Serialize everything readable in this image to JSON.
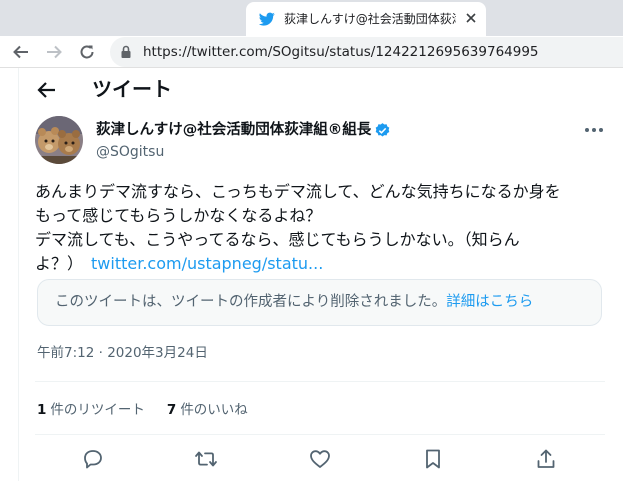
{
  "browser": {
    "tab_title": "荻津しんすけ@社会活動団体荻津組®組長",
    "url": "https://twitter.com/SOgitsu/status/1242212695639764995"
  },
  "header": {
    "title": "ツイート"
  },
  "tweet": {
    "author_name": "荻津しんすけ@社会活動団体荻津組®組長",
    "handle": "@SOgitsu",
    "text_lines": [
      "あんまりデマ流すなら、こっちもデマ流して、どんな気持ちになるか身を",
      "もって感じてもらうしかなくなるよね？",
      "デマ流しても、こうやってるなら、感じてもらうしかない。（知らん",
      "よ？）"
    ],
    "link_text": "twitter.com/ustapneg/statu...",
    "deleted_notice": "このツイートは、ツイートの作成者により削除されました。",
    "deleted_link": "詳細はこちら",
    "timestamp": "午前7:12 · 2020年3月24日",
    "retweet_count": "1",
    "retweet_label": "件のリツイート",
    "like_count": "7",
    "like_label": "件のいいね"
  },
  "icons": {
    "tab": "twitter-bird-icon",
    "close": "close-icon",
    "back": "back-arrow-icon",
    "forward": "forward-arrow-icon",
    "reload": "reload-icon",
    "lock": "lock-icon",
    "verified": "verified-badge-icon",
    "more": "more-icon",
    "reply": "reply-icon",
    "retweet": "retweet-icon",
    "like": "like-icon",
    "bookmark": "bookmark-icon",
    "share": "share-icon"
  },
  "colors": {
    "accent": "#1d9bf0",
    "text_primary": "#0f1419",
    "text_secondary": "#536471"
  }
}
